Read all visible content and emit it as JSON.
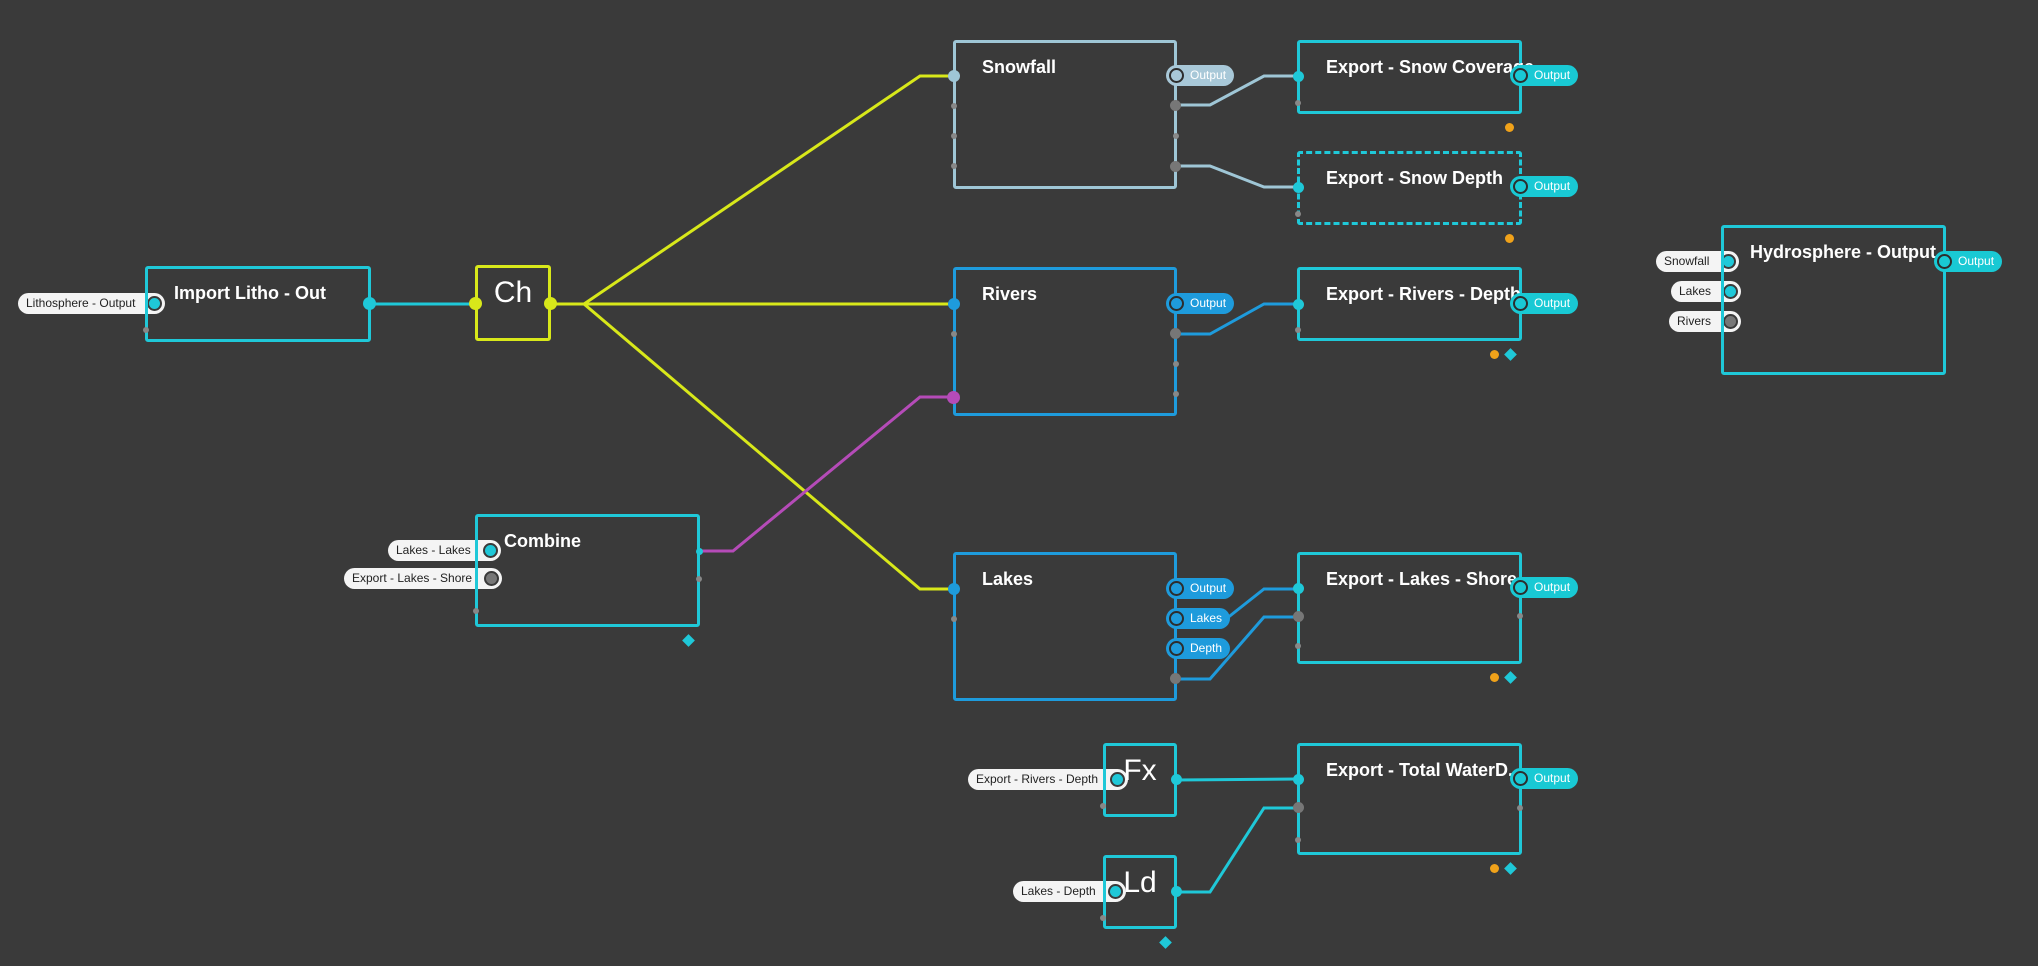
{
  "colors": {
    "background": "#3a3a3a",
    "cyan": "#1fc8d8",
    "blue": "#1e9bdc",
    "light_blue": "#9fc6d6",
    "yellow_wire": "#d8e81a",
    "magenta_wire": "#b54bb8",
    "orange_flag": "#f0a21a"
  },
  "nodes": {
    "import_litho": {
      "title": "Import Litho - Out",
      "input": "Lithosphere - Output"
    },
    "chooser": {
      "title": "Ch"
    },
    "combine": {
      "title": "Combine",
      "inputs": [
        "Lakes - Lakes",
        "Export - Lakes - Shore"
      ]
    },
    "snowfall": {
      "title": "Snowfall",
      "outputs": [
        "Output"
      ]
    },
    "rivers": {
      "title": "Rivers",
      "outputs": [
        "Output"
      ]
    },
    "lakes": {
      "title": "Lakes",
      "outputs": [
        "Output",
        "Lakes",
        "Depth"
      ]
    },
    "fx": {
      "title": "Fx",
      "input": "Export - Rivers - Depth"
    },
    "ld": {
      "title": "Ld",
      "input": "Lakes - Depth"
    },
    "export_snow_coverage": {
      "title": "Export - Snow Coverage",
      "output": "Output"
    },
    "export_snow_depth": {
      "title": "Export - Snow Depth",
      "output": "Output"
    },
    "export_rivers_depth": {
      "title": "Export - Rivers - Depth",
      "output": "Output"
    },
    "export_lakes_shore": {
      "title": "Export - Lakes - Shore",
      "output": "Output"
    },
    "export_total_water": {
      "title": "Export - Total WaterD...",
      "output": "Output"
    },
    "hydrosphere_output": {
      "title": "Hydrosphere - Output",
      "inputs": [
        "Snowfall",
        "Lakes",
        "Rivers"
      ],
      "output": "Output"
    }
  }
}
